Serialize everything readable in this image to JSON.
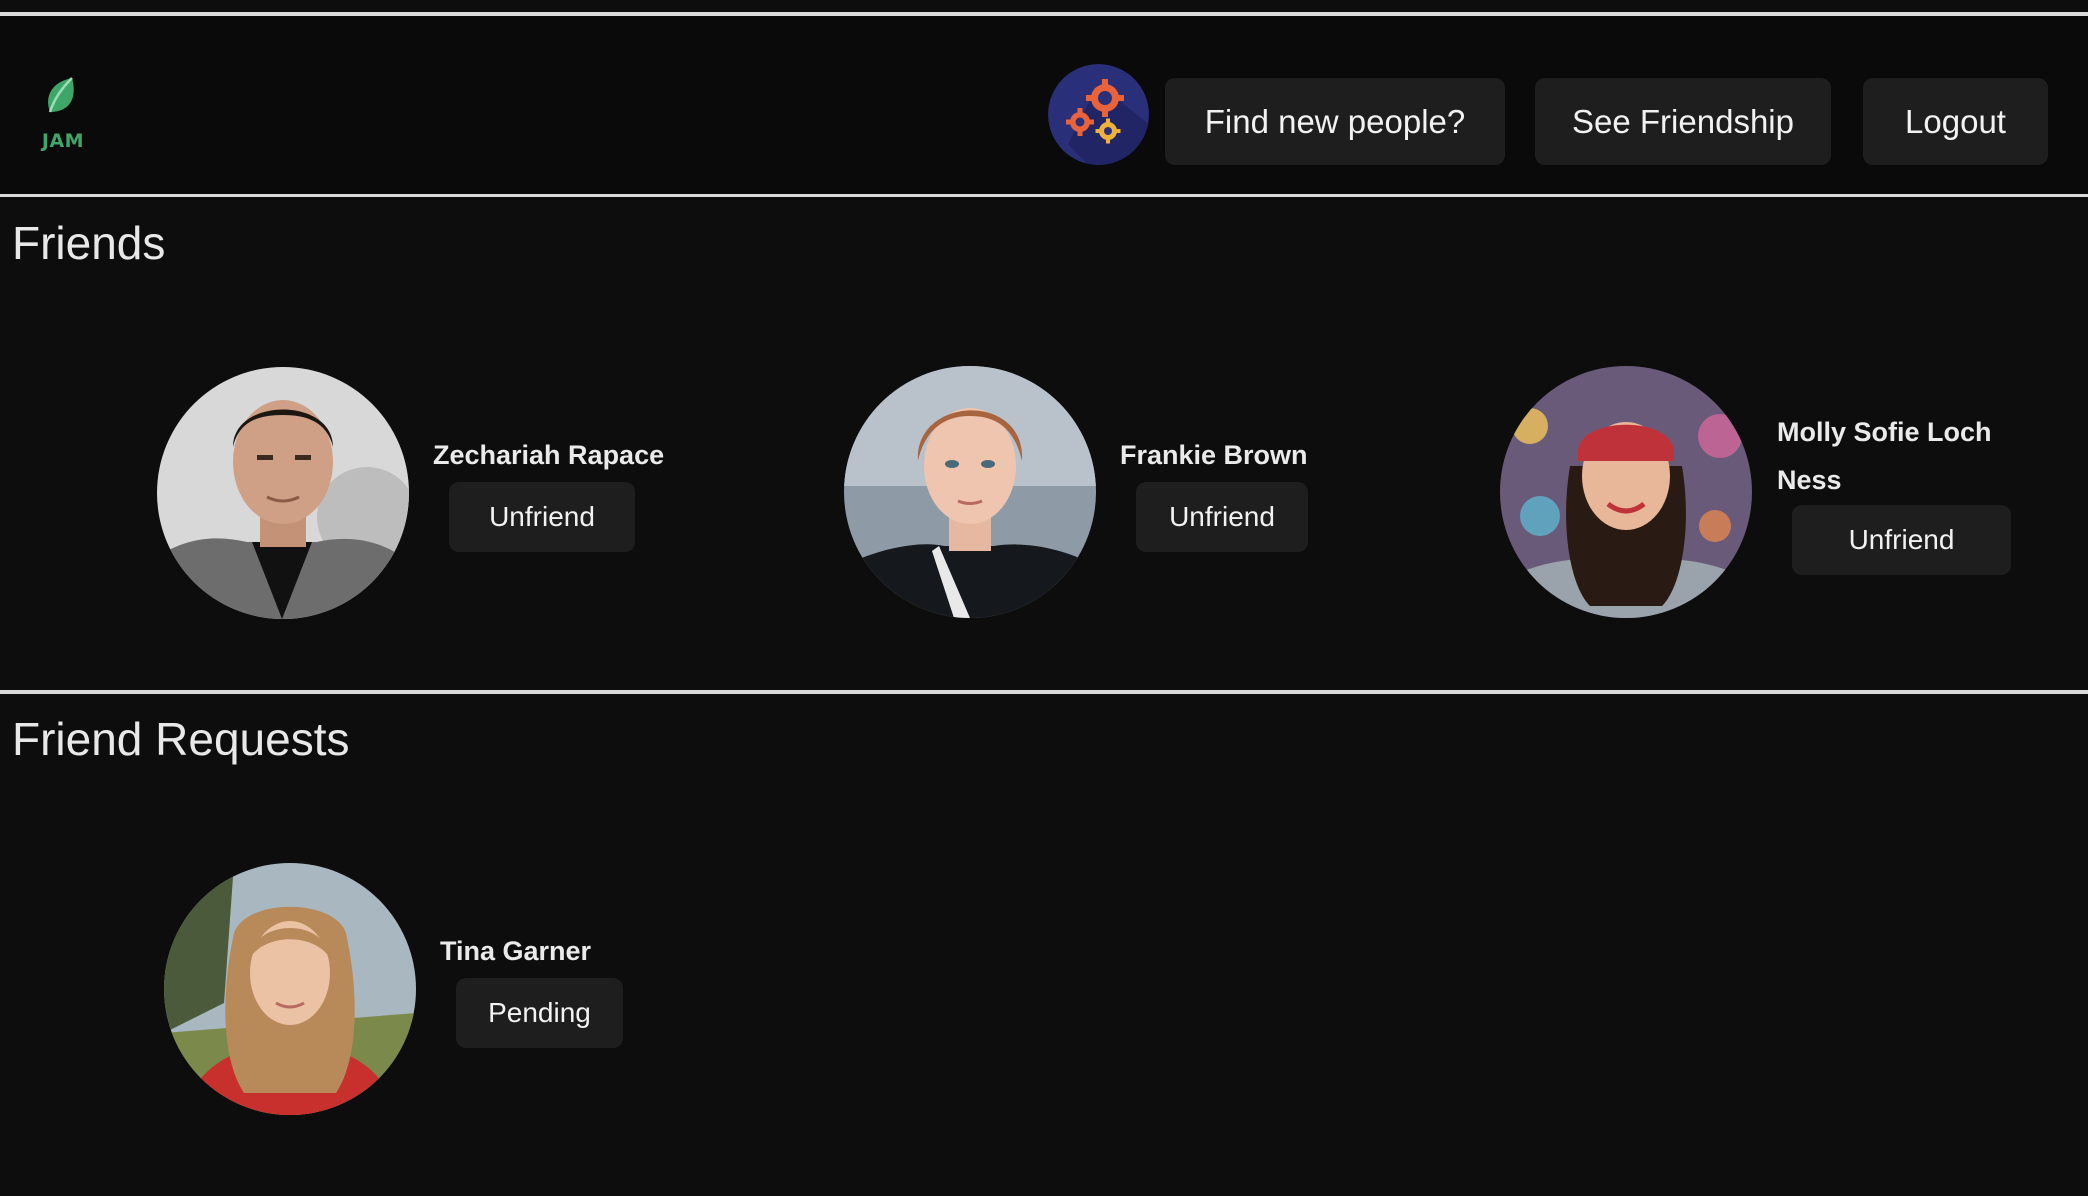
{
  "brand": {
    "logo_text": "JAM",
    "leaf_color": "#3fa66a"
  },
  "header": {
    "settings_icon": "gears-icon",
    "nav": [
      {
        "label": "Find new people?"
      },
      {
        "label": "See Friendship"
      },
      {
        "label": "Logout"
      }
    ]
  },
  "friends": {
    "title": "Friends",
    "people": [
      {
        "name": "Zechariah Rapace",
        "action": "Unfriend"
      },
      {
        "name": "Frankie Brown",
        "action": "Unfriend"
      },
      {
        "name": "Molly Sofie Loch Ness",
        "action": "Unfriend"
      }
    ]
  },
  "requests": {
    "title": "Friend Requests",
    "people": [
      {
        "name": "Tina Garner",
        "action": "Pending"
      }
    ]
  }
}
